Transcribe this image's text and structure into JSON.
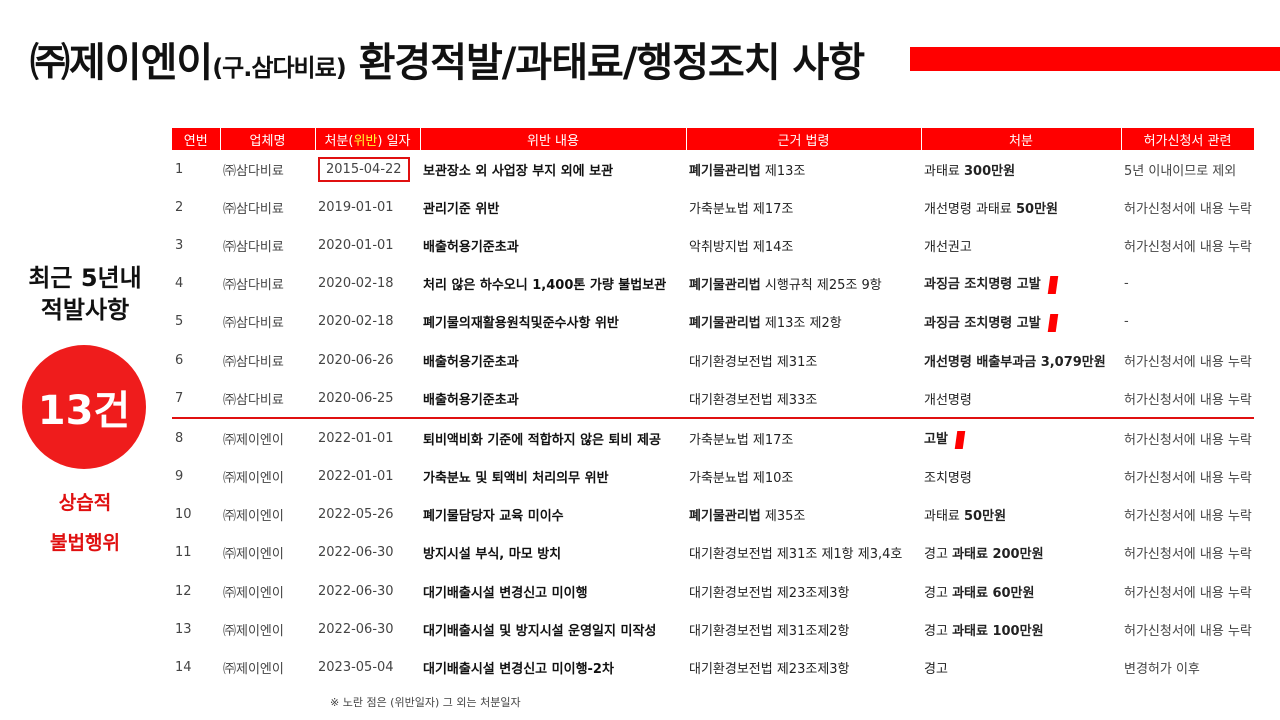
{
  "title": {
    "company": "㈜제이엔이",
    "former": "(구.삼다비료)",
    "subject": "환경적발/과태료/행정조치 사항"
  },
  "side": {
    "heading_line1": "최근 5년내",
    "heading_line2": "적발사항",
    "count": "13건",
    "note_line1": "상습적",
    "note_line2": "불법행위"
  },
  "table": {
    "headers": {
      "no": "연번",
      "company": "업체명",
      "date_pre": "처분(",
      "date_hl": "위반",
      "date_post": ") 일자",
      "violation": "위반 내용",
      "law": "근거 법령",
      "penalty": "처분",
      "permit": "허가신청서 관련"
    },
    "rows": [
      {
        "no": "1",
        "company": "㈜삼다비료",
        "date": "2015-04-22",
        "violation": "보관장소 외 사업장 부지 외에 보관",
        "law_bold": "폐기물관리법",
        "law_rest": " 제13조",
        "penalty_pre": "과태료 ",
        "penalty_bold": "300만원",
        "permit": "5년 이내이므로 제외"
      },
      {
        "no": "2",
        "company": "㈜삼다비료",
        "date": "2019-01-01",
        "violation": "관리기준 위반",
        "law_bold": "",
        "law_rest": "가축분뇨법 제17조",
        "penalty_pre": "개선명령 과태료 ",
        "penalty_bold": "50만원",
        "permit": "허가신청서에 내용 누락"
      },
      {
        "no": "3",
        "company": "㈜삼다비료",
        "date": "2020-01-01",
        "violation": "배출허용기준초과",
        "law_bold": "",
        "law_rest": "악취방지법 제14조",
        "penalty_pre": "개선권고",
        "penalty_bold": "",
        "permit": "허가신청서에 내용 누락"
      },
      {
        "no": "4",
        "company": "㈜삼다비료",
        "date": "2020-02-18",
        "violation": "처리 않은 하수오니 1,400톤 가량 불법보관",
        "law_bold": "폐기물관리법",
        "law_rest": " 시행규칙  제25조 9항",
        "penalty_pre": "",
        "penalty_bold": "과징금 조치명령 고발",
        "permit": "-"
      },
      {
        "no": "5",
        "company": "㈜삼다비료",
        "date": "2020-02-18",
        "violation": "폐기물의재활용원칙및준수사항 위반",
        "law_bold": "폐기물관리법",
        "law_rest": " 제13조 제2항",
        "penalty_pre": "",
        "penalty_bold": "과징금 조치명령 고발",
        "permit": "-"
      },
      {
        "no": "6",
        "company": "㈜삼다비료",
        "date": "2020-06-26",
        "violation": "배출허용기준초과",
        "law_bold": "",
        "law_rest": "대기환경보전법 제31조",
        "penalty_pre": "",
        "penalty_bold": "개선명령 배출부과금 3,079만원",
        "permit": "허가신청서에 내용 누락"
      },
      {
        "no": "7",
        "company": "㈜삼다비료",
        "date": "2020-06-25",
        "violation": "배출허용기준초과",
        "law_bold": "",
        "law_rest": "대기환경보전법 제33조",
        "penalty_pre": "개선명령",
        "penalty_bold": "",
        "permit": "허가신청서에 내용 누락"
      },
      {
        "no": "8",
        "company": "㈜제이엔이",
        "date": "2022-01-01",
        "violation": "퇴비액비화 기준에 적합하지 않은 퇴비 제공",
        "law_bold": "",
        "law_rest": "가축분뇨법 제17조",
        "penalty_pre": "",
        "penalty_bold": "고발",
        "permit": "허가신청서에 내용 누락"
      },
      {
        "no": "9",
        "company": "㈜제이엔이",
        "date": "2022-01-01",
        "violation": "가축분뇨 및 퇴액비 처리의무 위반",
        "law_bold": "",
        "law_rest": "가축분뇨법 제10조",
        "penalty_pre": "조치명령",
        "penalty_bold": "",
        "permit": "허가신청서에 내용 누락"
      },
      {
        "no": "10",
        "company": "㈜제이엔이",
        "date": "2022-05-26",
        "violation": "폐기물담당자 교육 미이수",
        "law_bold": "폐기물관리법",
        "law_rest": " 제35조",
        "penalty_pre": "과태료 ",
        "penalty_bold": "50만원",
        "permit": "허가신청서에 내용 누락"
      },
      {
        "no": "11",
        "company": "㈜제이엔이",
        "date": "2022-06-30",
        "violation": "방지시설 부식, 마모 방치",
        "law_bold": "",
        "law_rest": "대기환경보전법 제31조 제1항 제3,4호",
        "penalty_pre": "경고 ",
        "penalty_bold": "과태료 200만원",
        "permit": "허가신청서에 내용 누락"
      },
      {
        "no": "12",
        "company": "㈜제이엔이",
        "date": "2022-06-30",
        "violation": "대기배출시설 변경신고 미이행",
        "law_bold": "",
        "law_rest": "대기환경보전법 제23조제3항",
        "penalty_pre": "경고 ",
        "penalty_bold": "과태료 60만원",
        "permit": "허가신청서에 내용 누락"
      },
      {
        "no": "13",
        "company": "㈜제이엔이",
        "date": "2022-06-30",
        "violation": "대기배출시설 및 방지시설 운영일지 미작성",
        "law_bold": "",
        "law_rest": "대기환경보전법 제31조제2항",
        "penalty_pre": "경고 ",
        "penalty_bold": "과태료 100만원",
        "permit": "허가신청서에 내용 누락"
      },
      {
        "no": "14",
        "company": "㈜제이엔이",
        "date": "2023-05-04",
        "violation": "대기배출시설 변경신고 미이행-2차",
        "law_bold": "",
        "law_rest": "대기환경보전법 제23조제3항",
        "penalty_pre": "경고",
        "penalty_bold": "",
        "permit": "변경허가 이후"
      }
    ]
  },
  "footnote": "※ 노란 점은 (위반일자) 그 외는 처분일자",
  "colors": {
    "accent": "#ff0000",
    "dot": "#ffe600",
    "circle": "#ef1c1c"
  }
}
